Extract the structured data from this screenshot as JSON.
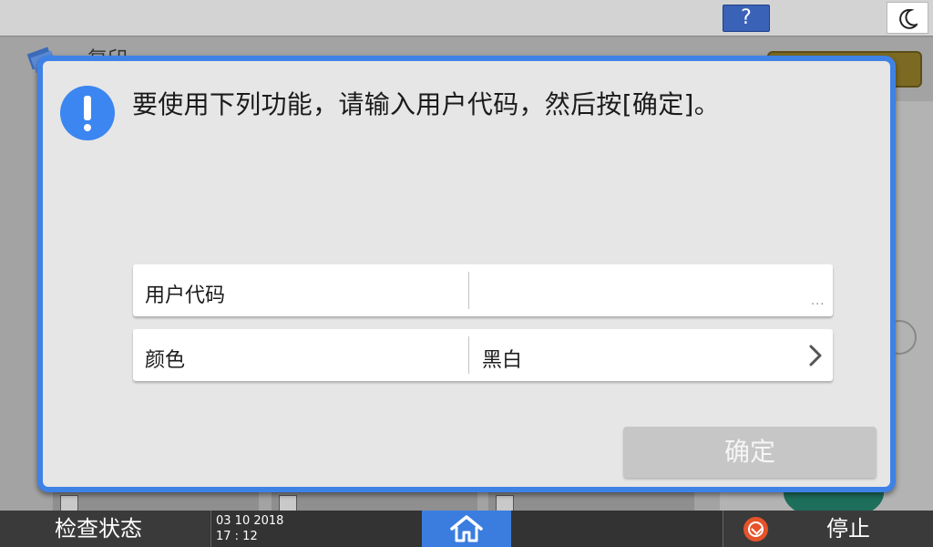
{
  "topbar": {
    "help_label": "?",
    "help_icon": "question-mark-icon",
    "sleep_icon": "moon-icon"
  },
  "background_app": {
    "title": "复印"
  },
  "dialog": {
    "icon": "exclamation-icon",
    "message": "要使用下列功能，请输入用户代码，然后按[确定]。",
    "fields": [
      {
        "label": "用户代码",
        "value": "",
        "indicator": "···"
      },
      {
        "label": "颜色",
        "value": "黑白",
        "indicator": "chevron-right-icon"
      }
    ],
    "ok_label": "确定"
  },
  "bottombar": {
    "status_label": "检查状态",
    "date": "03 10 2018",
    "time": "17 : 12",
    "home_icon": "home-icon",
    "stop_label": "停止",
    "stop_icon": "stop-icon"
  },
  "colors": {
    "dialog_border": "#3f82e6",
    "alert_icon": "#3b86f0",
    "home_button": "#3a7ddf",
    "stop_icon": "#e6532a",
    "help_button": "#3a62b7"
  }
}
